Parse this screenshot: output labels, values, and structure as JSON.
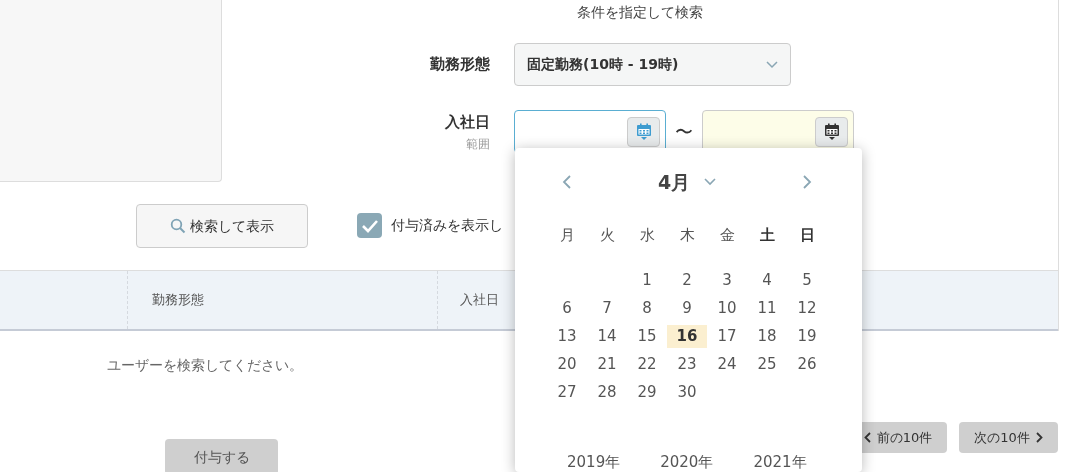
{
  "search_form": {
    "title": "条件を指定して検索",
    "fields": [
      {
        "kind": "select",
        "label": "勤務形態",
        "value": "固定勤務(10時 - 19時)"
      },
      {
        "kind": "date_range",
        "label": "入社日",
        "sublabel": "範囲",
        "separator": "〜",
        "inputs": [
          {
            "focused": true,
            "highlighted": false
          },
          {
            "focused": false,
            "highlighted": true
          }
        ]
      }
    ]
  },
  "search_button": "検索して表示",
  "show_granted": {
    "label": "付与済みを表示し",
    "checked": true
  },
  "table": {
    "columns": [
      "勤務形態",
      "入社日"
    ],
    "empty_message": "ユーザーを検索してください。"
  },
  "grant_button": "付与する",
  "pagination": {
    "prev": "前の10件",
    "next": "次の10件"
  },
  "calendar": {
    "month": "4月",
    "weekdays": [
      {
        "label": "月",
        "weekend": false
      },
      {
        "label": "火",
        "weekend": false
      },
      {
        "label": "水",
        "weekend": false
      },
      {
        "label": "木",
        "weekend": false
      },
      {
        "label": "金",
        "weekend": false
      },
      {
        "label": "土",
        "weekend": true
      },
      {
        "label": "日",
        "weekend": true
      }
    ],
    "weeks": [
      {
        "kind": "offset",
        "days": [
          {
            "day": "1",
            "selected": false
          },
          {
            "day": "2",
            "selected": false
          },
          {
            "day": "3",
            "selected": false
          },
          {
            "day": "4",
            "selected": false
          },
          {
            "day": "5",
            "selected": false
          }
        ]
      },
      {
        "kind": "plain",
        "days": [
          {
            "day": "6",
            "selected": false
          },
          {
            "day": "7",
            "selected": false
          },
          {
            "day": "8",
            "selected": false
          },
          {
            "day": "9",
            "selected": false
          },
          {
            "day": "10",
            "selected": false
          },
          {
            "day": "11",
            "selected": false
          },
          {
            "day": "12",
            "selected": false
          }
        ]
      },
      {
        "kind": "plain",
        "days": [
          {
            "day": "13",
            "selected": false
          },
          {
            "day": "14",
            "selected": false
          },
          {
            "day": "15",
            "selected": false
          },
          {
            "day": "16",
            "selected": true
          },
          {
            "day": "17",
            "selected": false
          },
          {
            "day": "18",
            "selected": false
          },
          {
            "day": "19",
            "selected": false
          }
        ]
      },
      {
        "kind": "plain",
        "days": [
          {
            "day": "20",
            "selected": false
          },
          {
            "day": "21",
            "selected": false
          },
          {
            "day": "22",
            "selected": false
          },
          {
            "day": "23",
            "selected": false
          },
          {
            "day": "24",
            "selected": false
          },
          {
            "day": "25",
            "selected": false
          },
          {
            "day": "26",
            "selected": false
          }
        ]
      },
      {
        "kind": "plain",
        "days": [
          {
            "day": "27",
            "selected": false
          },
          {
            "day": "28",
            "selected": false
          },
          {
            "day": "29",
            "selected": false
          },
          {
            "day": "30",
            "selected": false
          }
        ]
      }
    ],
    "years": [
      "2019年",
      "2020年",
      "2021年"
    ]
  }
}
